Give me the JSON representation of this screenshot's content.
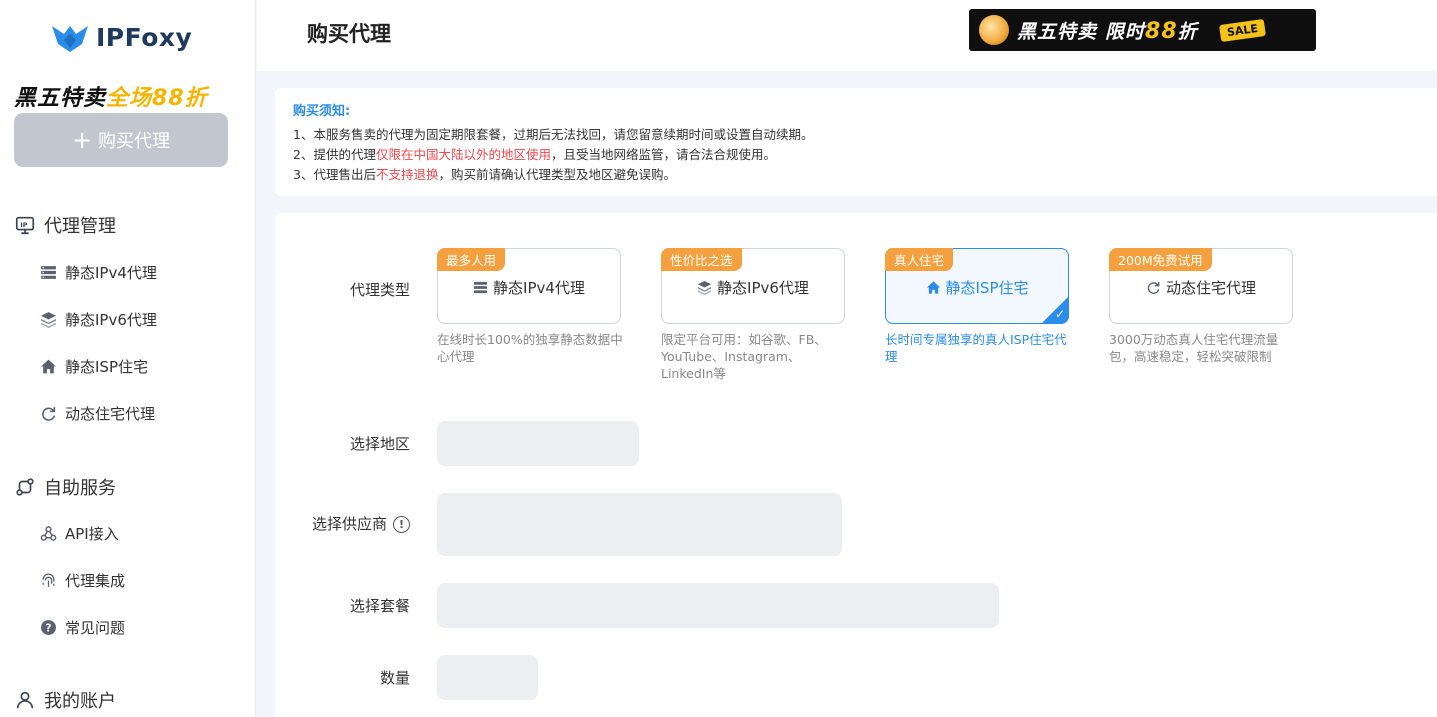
{
  "brand": {
    "name": "IPFoxy"
  },
  "sidebar": {
    "promo_part1": "黑五特卖",
    "promo_part2": "全场88折",
    "buy_button": "购买代理",
    "groups": [
      {
        "label": "代理管理",
        "icon": "ip-icon"
      },
      {
        "label": "自助服务",
        "icon": "route-icon"
      },
      {
        "label": "我的账户",
        "icon": "user-icon"
      }
    ],
    "items": [
      {
        "label": "静态IPv4代理",
        "icon": "server-icon"
      },
      {
        "label": "静态IPv6代理",
        "icon": "layers-icon"
      },
      {
        "label": "静态ISP住宅",
        "icon": "home-icon"
      },
      {
        "label": "动态住宅代理",
        "icon": "refresh-icon"
      },
      {
        "label": "API接入",
        "icon": "api-icon"
      },
      {
        "label": "代理集成",
        "icon": "fingerprint-icon"
      },
      {
        "label": "常见问题",
        "icon": "question-icon"
      }
    ]
  },
  "header": {
    "title": "购买代理",
    "promo_text1": "黑五特卖",
    "promo_text2_pre": "限时",
    "promo_text2_num": "88",
    "promo_text2_post": "折",
    "promo_badge": "SALE"
  },
  "notice": {
    "title": "购买须知:",
    "line1": "1、本服务售卖的代理为固定期限套餐，过期后无法找回，请您留意续期时间或设置自动续期。",
    "line2_a": "2、提供的代理",
    "line2_red": "仅限在中国大陆以外的地区使用",
    "line2_b": "，且受当地网络监管，请合法合规使用。",
    "line3_a": "3、代理售出后",
    "line3_red": "不支持退换",
    "line3_b": "，购买前请确认代理类型及地区避免误购。"
  },
  "form": {
    "type_label": "代理类型",
    "region_label": "选择地区",
    "provider_label": "选择供应商",
    "plan_label": "选择套餐",
    "quantity_label": "数量",
    "types": [
      {
        "tag": "最多人用",
        "name": "静态IPv4代理",
        "desc": "在线时长100%的独享静态数据中心代理",
        "selected": false
      },
      {
        "tag": "性价比之选",
        "name": "静态IPv6代理",
        "desc": "限定平台可用：如谷歌、FB、YouTube、Instagram、LinkedIn等",
        "selected": false
      },
      {
        "tag": "真人住宅",
        "name": "静态ISP住宅",
        "desc": "长时间专属独享的真人ISP住宅代理",
        "selected": true
      },
      {
        "tag": "200M免费试用",
        "name": "动态住宅代理",
        "desc": "3000万动态真人住宅代理流量包，高速稳定，轻松突破限制",
        "selected": false
      }
    ]
  },
  "colors": {
    "accent": "#2b8de9",
    "tag": "#f5a03f",
    "warning": "#f0474a",
    "promo_yellow": "#f5b400"
  }
}
